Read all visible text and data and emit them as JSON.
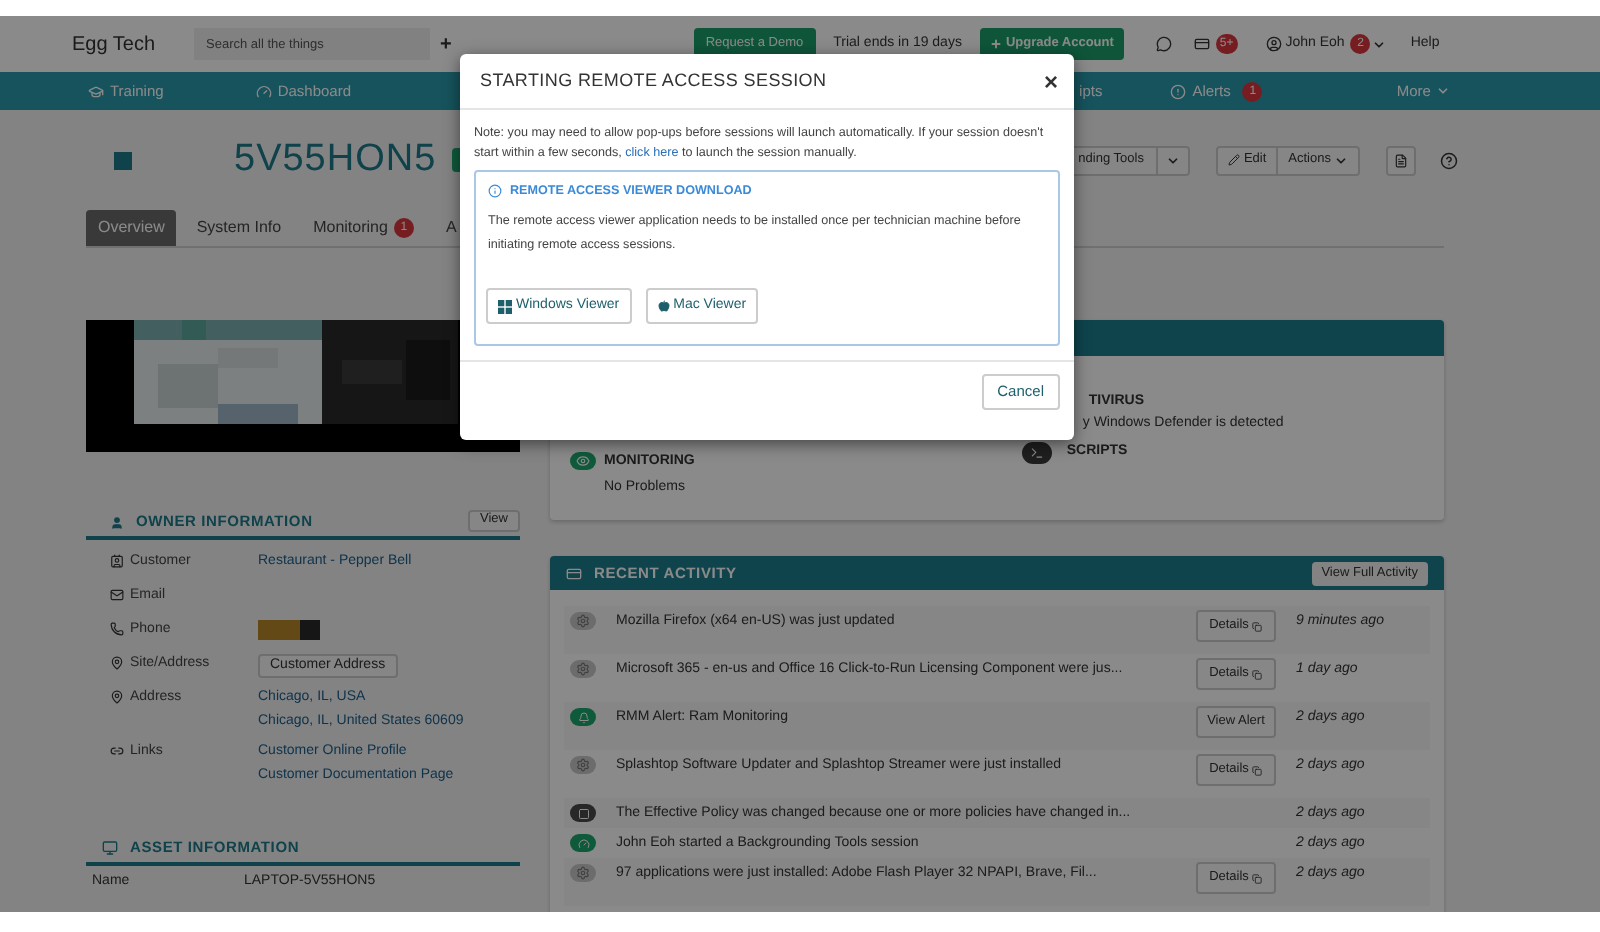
{
  "header": {
    "brand": "Egg Tech",
    "search": {
      "placeholder": "Search all the things"
    },
    "add": "+",
    "demo_button": "Request a Demo",
    "trial": "Trial ends in 19 days",
    "upgrade_button": "Upgrade Account",
    "notifications_badge": "5+",
    "user": "John Eoh",
    "user_badge": "2",
    "help": "Help"
  },
  "nav": [
    {
      "label": "Training"
    },
    {
      "label": "Dashboard"
    },
    {
      "label": "ipts"
    },
    {
      "label": "Alerts",
      "badge": "1"
    },
    {
      "label": "More"
    }
  ],
  "device": {
    "name": "5V55HON5",
    "tools_button": "nding Tools",
    "edit_button": "Edit",
    "actions_button": "Actions"
  },
  "tabs": [
    {
      "label": "Overview",
      "selected": true
    },
    {
      "label": "System Info",
      "selected": false
    },
    {
      "label": "Monitoring",
      "badge": "1",
      "selected": false
    },
    {
      "label": "A",
      "selected": false
    }
  ],
  "status": {
    "antivirus_title": "TIVIRUS",
    "antivirus_text": "y Windows Defender is detected",
    "scripts_title": "SCRIPTS",
    "monitoring_title": "MONITORING",
    "monitoring_text": "No Problems"
  },
  "owner": {
    "title": "OWNER INFORMATION",
    "view_button": "View",
    "rows": [
      {
        "label": "Customer",
        "kind": "link",
        "values": [
          "Restaurant - Pepper Bell"
        ]
      },
      {
        "label": "Email",
        "kind": "text"
      },
      {
        "label": "Phone",
        "kind": "redacted"
      },
      {
        "label": "Site/Address",
        "kind": "button",
        "values": [
          "Customer Address"
        ]
      },
      {
        "label": "Address",
        "kind": "link",
        "values": [
          "Chicago, IL, USA",
          "Chicago, IL, United States 60609"
        ]
      },
      {
        "label": "Links",
        "kind": "link",
        "values": [
          "Customer Online Profile",
          "Customer Documentation Page"
        ]
      }
    ]
  },
  "asset": {
    "title": "ASSET INFORMATION",
    "rows": [
      {
        "label": "Name",
        "value": "LAPTOP-5V55HON5"
      }
    ]
  },
  "activity": {
    "title": "RECENT ACTIVITY",
    "full_button": "View Full Activity",
    "rows": [
      {
        "kind": "update",
        "text": "Mozilla Firefox (x64 en-US) was just updated",
        "action": "Details",
        "time": "9 minutes ago"
      },
      {
        "kind": "update",
        "text": "Microsoft 365 - en-us and Office 16 Click-to-Run Licensing Component were jus...",
        "action": "Details",
        "time": "1 day ago"
      },
      {
        "kind": "alert",
        "text": "RMM Alert: Ram Monitoring",
        "action": "View Alert",
        "time": "2 days ago"
      },
      {
        "kind": "update",
        "text": "Splashtop Software Updater and Splashtop Streamer were just installed",
        "action": "Details",
        "time": "2 days ago"
      },
      {
        "kind": "policy",
        "text": "The Effective Policy was changed because one or more policies have changed in...",
        "time": "2 days ago"
      },
      {
        "kind": "session",
        "text": "John Eoh started a Backgrounding Tools session",
        "time": "2 days ago"
      },
      {
        "kind": "update",
        "text": "97 applications were just installed: Adobe Flash Player 32 NPAPI, Brave, Fil...",
        "action": "Details",
        "time": "2 days ago"
      }
    ]
  },
  "modal": {
    "title": "STARTING REMOTE ACCESS SESSION",
    "close": "×",
    "note_before": "Note: you may need to allow pop-ups before sessions will launch automatically. If your session doesn't start within a few seconds, ",
    "note_link": "click here",
    "note_after": " to launch the session manually.",
    "download_title": "REMOTE ACCESS VIEWER DOWNLOAD",
    "download_text": "The remote access viewer application needs to be installed once per technician machine before initiating remote access sessions.",
    "buttons": [
      "Windows Viewer",
      "Mac Viewer"
    ],
    "cancel": "Cancel"
  }
}
